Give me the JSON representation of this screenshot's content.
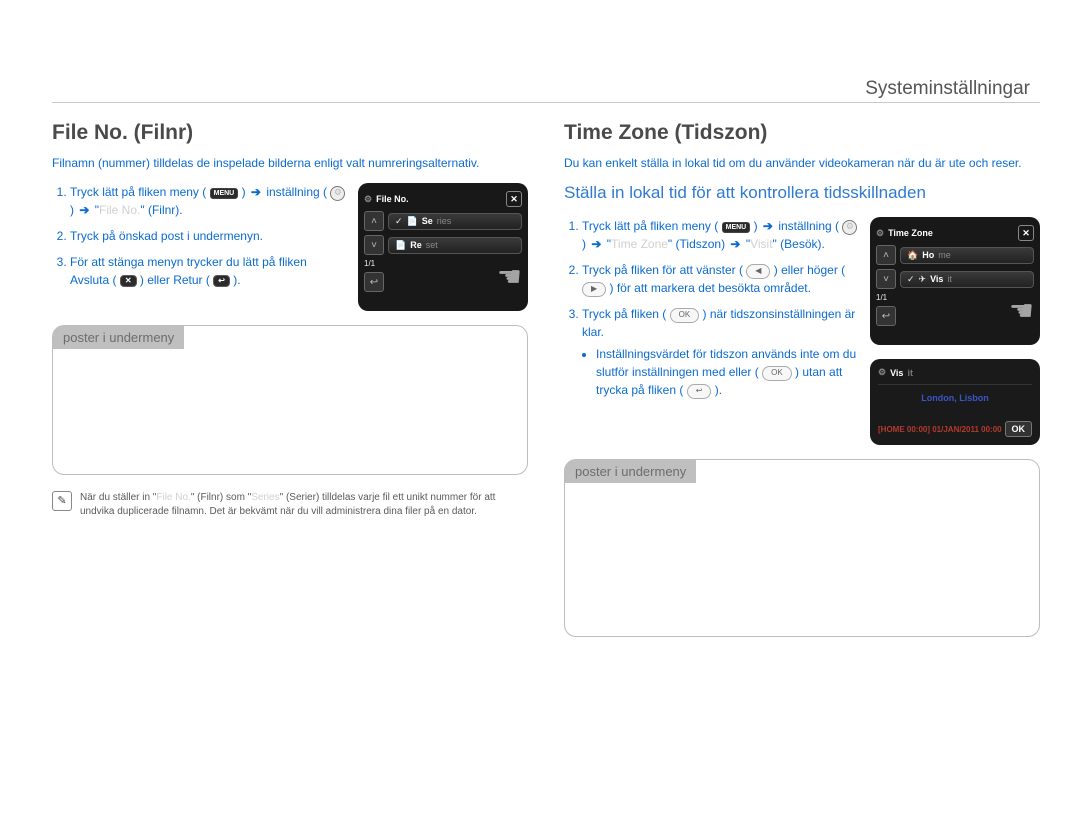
{
  "header": "Systeminställningar",
  "left": {
    "title": "File No. (Filnr)",
    "lead": "Filnamn (nummer) tilldelas de inspelade bilderna enligt valt numreringsalternativ.",
    "steps": {
      "s1a": "Tryck lätt på fliken meny (",
      "s1b": ") ",
      "s1arrow": "➔",
      "s1c": " inställning (",
      "s1d": ") ",
      "s1arrow2": "➔",
      "s1q1": "\"",
      "s1faded": "File No.",
      "s1q2": "\" (Filnr).",
      "s2": "Tryck på önskad post i undermenyn.",
      "s3a": "För att stänga menyn trycker du lätt på fliken Avsluta (",
      "s3b": ") eller Retur (",
      "s3c": ")."
    },
    "screen": {
      "title": "File No.",
      "item1_strong": "Se",
      "item1_faded": "ries",
      "item2_strong": "Re",
      "item2_faded": "set",
      "page": "1/1"
    },
    "sub_tab": "poster i undermeny",
    "footnote_a": "När du ställer in \"",
    "footnote_faded1": "File No.",
    "footnote_b": "\" (Filnr) som \"",
    "footnote_faded2": "Series",
    "footnote_c": "\" (Serier) tilldelas varje fil ett unikt nummer för att undvika duplicerade filnamn. Det är bekvämt när du vill administrera dina filer på en dator."
  },
  "right": {
    "title": "Time Zone (Tidszon)",
    "lead": "Du kan enkelt ställa in lokal tid om du använder videokameran när du är ute och reser.",
    "subtitle": "Ställa in lokal tid för att kontrollera tidsskillnaden",
    "steps": {
      "s1a": "Tryck lätt på fliken meny (",
      "s1b": ") ",
      "s1arrow": "➔",
      "s1c": " inställning (",
      "s1d": ") ",
      "s1arrow2": "➔",
      "s1q1": " \"",
      "s1faded": "Time Zone",
      "s1q2": "\" (Tidszon) ",
      "s1arrow3": "➔",
      "s1q3": " \"",
      "s1faded2": "Visit",
      "s1q4": "\" (Besök).",
      "s2a": "Tryck på fliken för att vänster (",
      "s2b": ") eller höger (",
      "s2c": ") för att markera det besökta området.",
      "s3a": "Tryck på fliken (",
      "s3b": ") när tidszonsinställningen är klar.",
      "s3bullet_a": "Inställningsvärdet för tidszon används inte om du slutför inställningen med eller (",
      "s3bullet_b": ") utan att trycka på fliken (",
      "s3bullet_c": ")."
    },
    "screen1": {
      "title": "Time Zone",
      "item1_strong": "Ho",
      "item1_faded": "me",
      "item2_strong": "Vis",
      "item2_faded": "it",
      "page": "1/1"
    },
    "screen2": {
      "hdr_strong": "Vis",
      "hdr_faded": "it",
      "city": "London, Lisbon",
      "time": "[HOME 00:00] 01/JAN/2011 00:00",
      "ok": "OK"
    },
    "sub_tab": "poster i undermeny"
  },
  "icons": {
    "menu": "MENU",
    "gear": "⚙",
    "close": "✕",
    "back": "↩",
    "ok": "OK",
    "left": "◀",
    "right": "▶",
    "up": "˄",
    "down": "˅",
    "hand": "☚",
    "check": "✓",
    "home": "🏠",
    "airplane": "✈",
    "doc": "📄",
    "note": "✎"
  }
}
